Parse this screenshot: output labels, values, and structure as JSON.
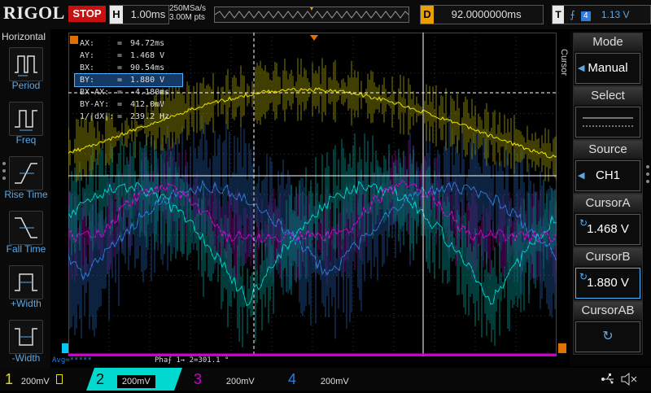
{
  "brand": "RIGOL",
  "run_state": "STOP",
  "timebase": {
    "label": "H",
    "value": "1.00ms"
  },
  "acquisition": {
    "sample_rate": "250MSa/s",
    "points": "3.00M pts"
  },
  "delay": {
    "label": "D",
    "value": "92.0000000ms"
  },
  "trigger": {
    "label": "T",
    "edge_symbol": "⨍",
    "channel": "4",
    "level": "1.13 V"
  },
  "left_menu": {
    "title": "Horizontal",
    "items": [
      {
        "label": "Period"
      },
      {
        "label": "Freq"
      },
      {
        "label": "Rise Time"
      },
      {
        "label": "Fall Time"
      },
      {
        "label": "+Width"
      },
      {
        "label": "-Width"
      }
    ]
  },
  "cursor_readout": [
    {
      "key": "AX:",
      "value": "94.72ms"
    },
    {
      "key": "AY:",
      "value": "1.468 V"
    },
    {
      "key": "BX:",
      "value": "90.54ms"
    },
    {
      "key": "BY:",
      "value": "1.880 V"
    },
    {
      "key": "BX-AX:",
      "value": "-4.180ms"
    },
    {
      "key": "BY-AY:",
      "value": "412.0mV"
    },
    {
      "key": "1/|dX|:",
      "value": "239.2 Hz"
    }
  ],
  "status_line": {
    "avg": "Avg=*****",
    "phase": "Pha⨍ 1→ 2=301.1 °"
  },
  "channels": [
    {
      "num": "1",
      "scale": "200mV",
      "color": "#e8e000"
    },
    {
      "num": "2",
      "scale": "200mV",
      "color": "#00d8d0"
    },
    {
      "num": "3",
      "scale": "200mV",
      "color": "#d000d0"
    },
    {
      "num": "4",
      "scale": "200mV",
      "color": "#2d7de0"
    }
  ],
  "right_menu": {
    "vertical_title": "Cursor",
    "mode": {
      "title": "Mode",
      "value": "Manual"
    },
    "select": {
      "title": "Select"
    },
    "source": {
      "title": "Source",
      "value": "CH1"
    },
    "cursor_a": {
      "title": "CursorA",
      "value": "1.468 V"
    },
    "cursor_b": {
      "title": "CursorB",
      "value": "1.880 V"
    },
    "cursor_ab": {
      "title": "CursorAB"
    }
  },
  "icons": [
    "usb-icon",
    "speaker-mute-icon"
  ]
}
